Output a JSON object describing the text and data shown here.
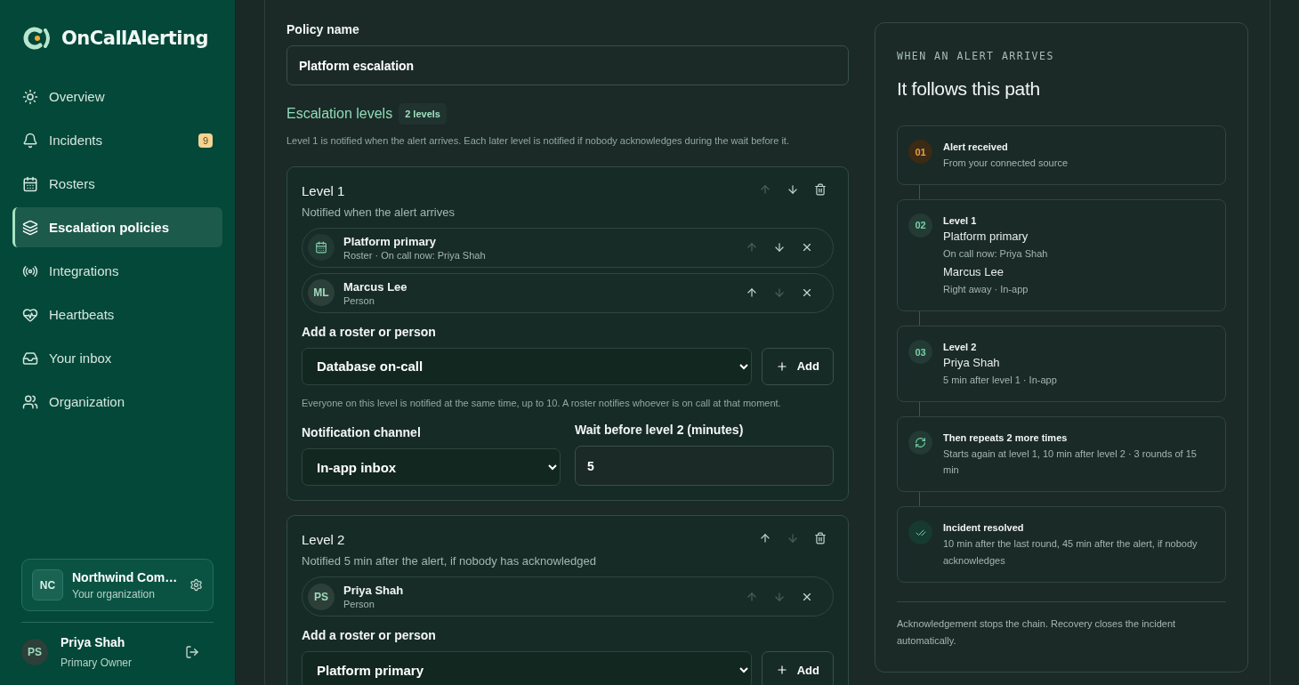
{
  "brand": {
    "name": "OnCallAlerting"
  },
  "nav": [
    {
      "label": "Overview",
      "selected": false
    },
    {
      "label": "Incidents",
      "selected": false,
      "badge": "9"
    },
    {
      "label": "Rosters",
      "selected": false
    },
    {
      "label": "Escalation policies",
      "selected": true
    },
    {
      "label": "Integrations",
      "selected": false
    },
    {
      "label": "Heartbeats",
      "selected": false
    },
    {
      "label": "Your inbox",
      "selected": false
    },
    {
      "label": "Organization",
      "selected": false
    }
  ],
  "organization": {
    "initials": "NC",
    "name": "Northwind Com…",
    "role": "Your organization"
  },
  "user": {
    "initials": "PS",
    "name": "Priya Shah",
    "role": "Primary Owner"
  },
  "policy": {
    "label": "Policy name",
    "value": "Platform escalation"
  },
  "levels_heading": {
    "title": "Escalation levels",
    "count": "2 levels",
    "hint": "Level 1 is notified when the alert arrives. Each later level is notified if nobody acknowledges during the wait before it."
  },
  "levels": [
    {
      "title": "Level 1",
      "subtitle": "Notified when the alert arrives",
      "up_disabled": true,
      "down_disabled": false,
      "members": [
        {
          "kind": "roster",
          "name": "Platform primary",
          "detail": "Roster · On call now: Priya Shah",
          "up_disabled": true,
          "down_disabled": false
        },
        {
          "kind": "person",
          "initials": "ML",
          "name": "Marcus Lee",
          "detail": "Person",
          "up_disabled": false,
          "down_disabled": true
        }
      ],
      "add_label": "Add a roster or person",
      "add_select": "Database on-call",
      "add_button": "Add",
      "hint": "Everyone on this level is notified at the same time, up to 10. A roster notifies whoever is on call at that moment.",
      "channel_label": "Notification channel",
      "channel": "In-app inbox",
      "wait_label": "Wait before level 2 (minutes)",
      "wait": "5"
    },
    {
      "title": "Level 2",
      "subtitle": "Notified 5 min after the alert, if nobody has acknowledged",
      "up_disabled": false,
      "down_disabled": true,
      "members": [
        {
          "kind": "person",
          "initials": "PS",
          "name": "Priya Shah",
          "detail": "Person",
          "up_disabled": true,
          "down_disabled": true
        }
      ],
      "add_label": "Add a roster or person",
      "add_select": "Platform primary",
      "add_button": "Add"
    }
  ],
  "path": {
    "eyebrow": "WHEN AN ALERT ARRIVES",
    "title": "It follows this path",
    "steps": [
      {
        "kind": "start",
        "number": "01",
        "title": "Alert received",
        "lines": [
          {
            "kind": "note",
            "text": "From your connected source"
          }
        ]
      },
      {
        "kind": "level",
        "number": "02",
        "title": "Level 1",
        "lines": [
          {
            "kind": "name",
            "text": "Platform primary"
          },
          {
            "kind": "note",
            "text": "On call now: Priya Shah"
          },
          {
            "kind": "name",
            "text": "Marcus Lee"
          },
          {
            "kind": "note",
            "text": "Right away · In-app"
          }
        ]
      },
      {
        "kind": "level",
        "number": "03",
        "title": "Level 2",
        "lines": [
          {
            "kind": "name",
            "text": "Priya Shah"
          },
          {
            "kind": "note",
            "text": "5 min after level 1 · In-app"
          }
        ]
      },
      {
        "kind": "repeat",
        "title": "Then repeats 2 more times",
        "lines": [
          {
            "kind": "note",
            "text": "Starts again at level 1, 10 min after level 2 · 3 rounds of 15 min"
          }
        ]
      },
      {
        "kind": "resolved",
        "title": "Incident resolved",
        "lines": [
          {
            "kind": "note",
            "text": "10 min after the last round, 45 min after the alert, if nobody acknowledges"
          }
        ]
      }
    ],
    "footer": "Acknowledgement stops the chain. Recovery closes the incident automatically."
  }
}
